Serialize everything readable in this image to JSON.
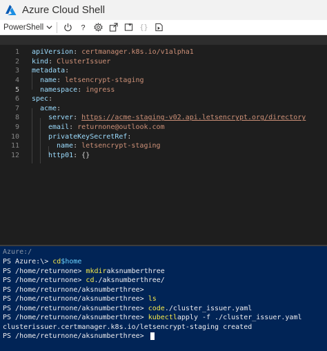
{
  "app": {
    "title": "Azure Cloud Shell"
  },
  "toolbar": {
    "shell": "PowerShell",
    "icons": [
      "power-icon",
      "help-icon",
      "settings-icon",
      "upload-download-icon",
      "new-session-icon",
      "braces-icon",
      "web-preview-icon"
    ]
  },
  "editor": {
    "lines": [
      {
        "n": "1",
        "key": "apiVersion",
        "value": "certmanager.k8s.io/v1alpha1"
      },
      {
        "n": "2",
        "key": "kind",
        "value": "ClusterIssuer"
      },
      {
        "n": "3",
        "key": "metadata",
        "value": ""
      },
      {
        "n": "4",
        "key": "name",
        "value": "letsencrypt-staging"
      },
      {
        "n": "5",
        "key": "namespace",
        "value": "ingress"
      },
      {
        "n": "6",
        "key": "spec",
        "value": ""
      },
      {
        "n": "7",
        "key": "acme",
        "value": ""
      },
      {
        "n": "8",
        "key": "server",
        "value": "https://acme-staging-v02.api.letsencrypt.org/directory"
      },
      {
        "n": "9",
        "key": "email",
        "value": "returnone@outlook.com"
      },
      {
        "n": "10",
        "key": "privateKeySecretRef",
        "value": ""
      },
      {
        "n": "11",
        "key": "name",
        "value": "letsencrypt-staging"
      },
      {
        "n": "12",
        "key": "http01",
        "value": "{}"
      }
    ]
  },
  "terminal": {
    "header": "Azure:/",
    "lines": [
      {
        "prompt": "PS Azure:\\> ",
        "cmd": "cd",
        "arg": "$home"
      },
      {
        "prompt": "PS /home/returnone> ",
        "cmd": "mkdir",
        "arg": "aksnumberthree"
      },
      {
        "prompt": "PS /home/returnone> ",
        "cmd": "cd",
        "arg": "./aksnumberthree/"
      },
      {
        "prompt": "PS /home/returnone/aksnumberthree> ",
        "cmd": "",
        "arg": ""
      },
      {
        "prompt": "PS /home/returnone/aksnumberthree> ",
        "cmd": "ls",
        "arg": ""
      },
      {
        "prompt": "PS /home/returnone/aksnumberthree> ",
        "cmd": "code",
        "arg": "./cluster_issuer.yaml"
      },
      {
        "prompt": "PS /home/returnone/aksnumberthree> ",
        "cmd": "kubectl",
        "arg": "apply -f ./cluster_issuer.yaml"
      },
      {
        "output": "clusterissuer.certmanager.k8s.io/letsencrypt-staging created"
      },
      {
        "prompt": "PS /home/returnone/aksnumberthree> ",
        "cmd": "",
        "arg": ""
      }
    ]
  }
}
